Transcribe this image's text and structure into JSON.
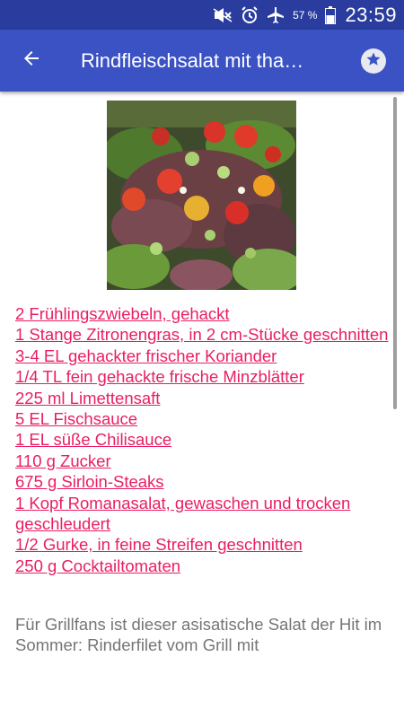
{
  "status_bar": {
    "battery_percent": "57 %",
    "time": "23:59",
    "icons": [
      "mute-icon",
      "alarm-icon",
      "airplane-icon",
      "battery-icon"
    ]
  },
  "app_bar": {
    "title": "Rindfleischsalat mit tha…",
    "back_icon": "arrow-left-icon",
    "favorite_icon": "star-icon"
  },
  "ingredients": [
    "2 Frühlingszwiebeln, gehackt",
    "1 Stange Zitronengras, in 2 cm-Stücke geschnitten",
    "3-4 EL gehackter frischer Koriander",
    "1/4 TL fein gehackte frische Minzblätter",
    "225 ml Limettensaft",
    "5 EL Fischsauce",
    "1 EL süße Chilisauce",
    "110 g Zucker",
    "675 g Sirloin-Steaks",
    "1 Kopf Romanasalat, gewaschen und trocken geschleudert",
    "1/2 Gurke, in feine Streifen geschnitten",
    "250 g Cocktailtomaten"
  ],
  "description": "Für Grillfans ist dieser asisatische Salat der Hit im Sommer: Rinderfilet vom Grill mit",
  "colors": {
    "status_bar": "#2a3d9e",
    "app_bar": "#3b52c4",
    "link": "#e91e63",
    "body_text": "#757575"
  }
}
